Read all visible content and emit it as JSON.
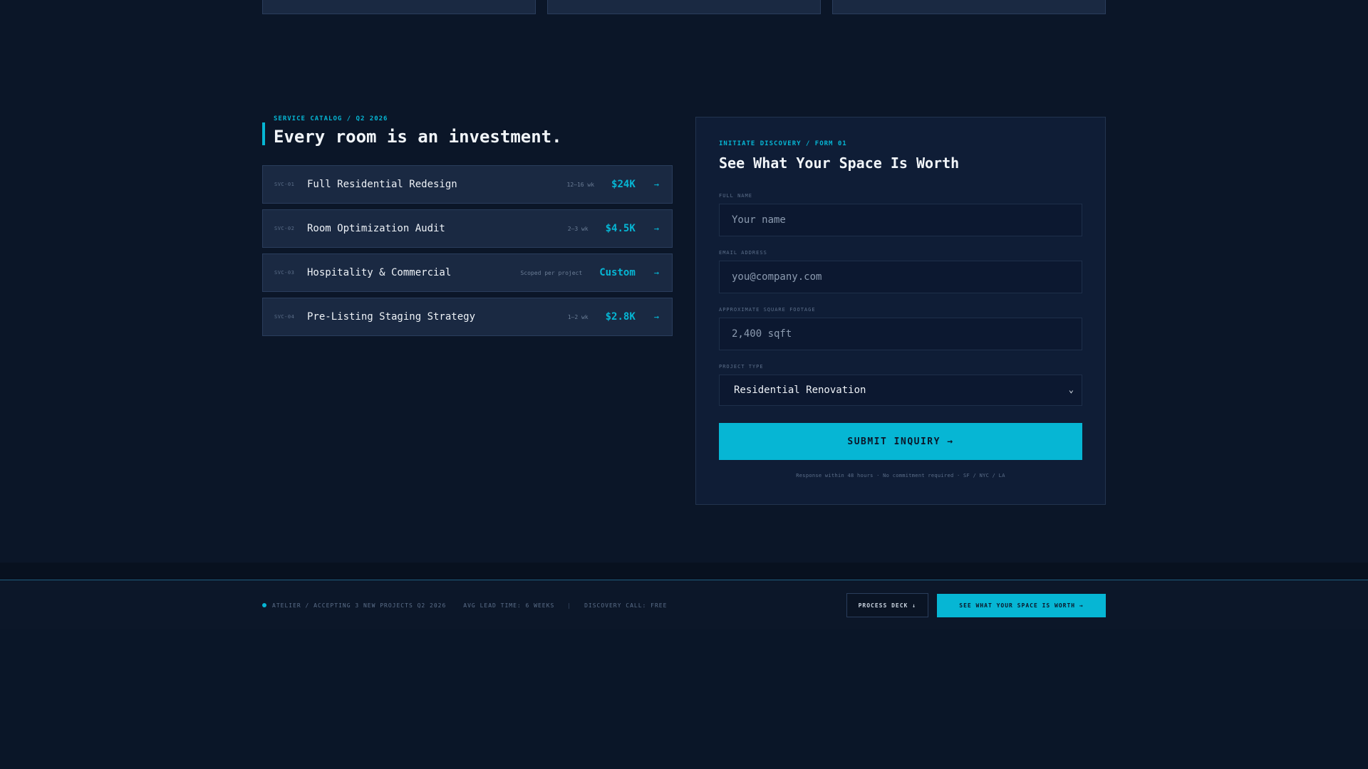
{
  "catalog": {
    "eyebrow": "SERVICE CATALOG / Q2 2026",
    "title": "Every room is an investment.",
    "services": [
      {
        "code": "SVC-01",
        "name": "Full Residential Redesign",
        "time": "12–16 wk",
        "price": "$24K",
        "arrow": "→"
      },
      {
        "code": "SVC-02",
        "name": "Room Optimization Audit",
        "time": "2–3 wk",
        "price": "$4.5K",
        "arrow": "→"
      },
      {
        "code": "SVC-03",
        "name": "Hospitality & Commercial",
        "time": "Scoped per project",
        "price": "Custom",
        "arrow": "→"
      },
      {
        "code": "SVC-04",
        "name": "Pre-Listing Staging Strategy",
        "time": "1–2 wk",
        "price": "$2.8K",
        "arrow": "→"
      }
    ]
  },
  "form": {
    "eyebrow": "INITIATE DISCOVERY / FORM 01",
    "title": "See What Your Space Is Worth",
    "name_label": "FULL NAME",
    "name_placeholder": "Your name",
    "email_label": "EMAIL ADDRESS",
    "email_placeholder": "you@company.com",
    "sqft_label": "APPROXIMATE SQUARE FOOTAGE",
    "sqft_placeholder": "2,400 sqft",
    "type_label": "PROJECT TYPE",
    "type_selected": "Residential Renovation",
    "submit_label": "SUBMIT INQUIRY →",
    "note": "Response within 48 hours · No commitment required · SF / NYC / LA"
  },
  "footer": {
    "status": "ATELIER / ACCEPTING 3 NEW PROJECTS Q2 2026",
    "lead_time": "AVG LEAD TIME: 6 WEEKS",
    "separator": "|",
    "discovery": "DISCOVERY CALL: FREE",
    "process_button": "PROCESS DECK ↓",
    "cta_button": "SEE WHAT YOUR SPACE IS WORTH →"
  },
  "colors": {
    "accent": "#06b6d4",
    "background": "#0b1628",
    "card": "#1a2942"
  },
  "icons": {
    "row_arrow": "arrow-right-icon",
    "select_chevron": "chevron-down-icon",
    "status_dot": "status-dot-icon"
  }
}
